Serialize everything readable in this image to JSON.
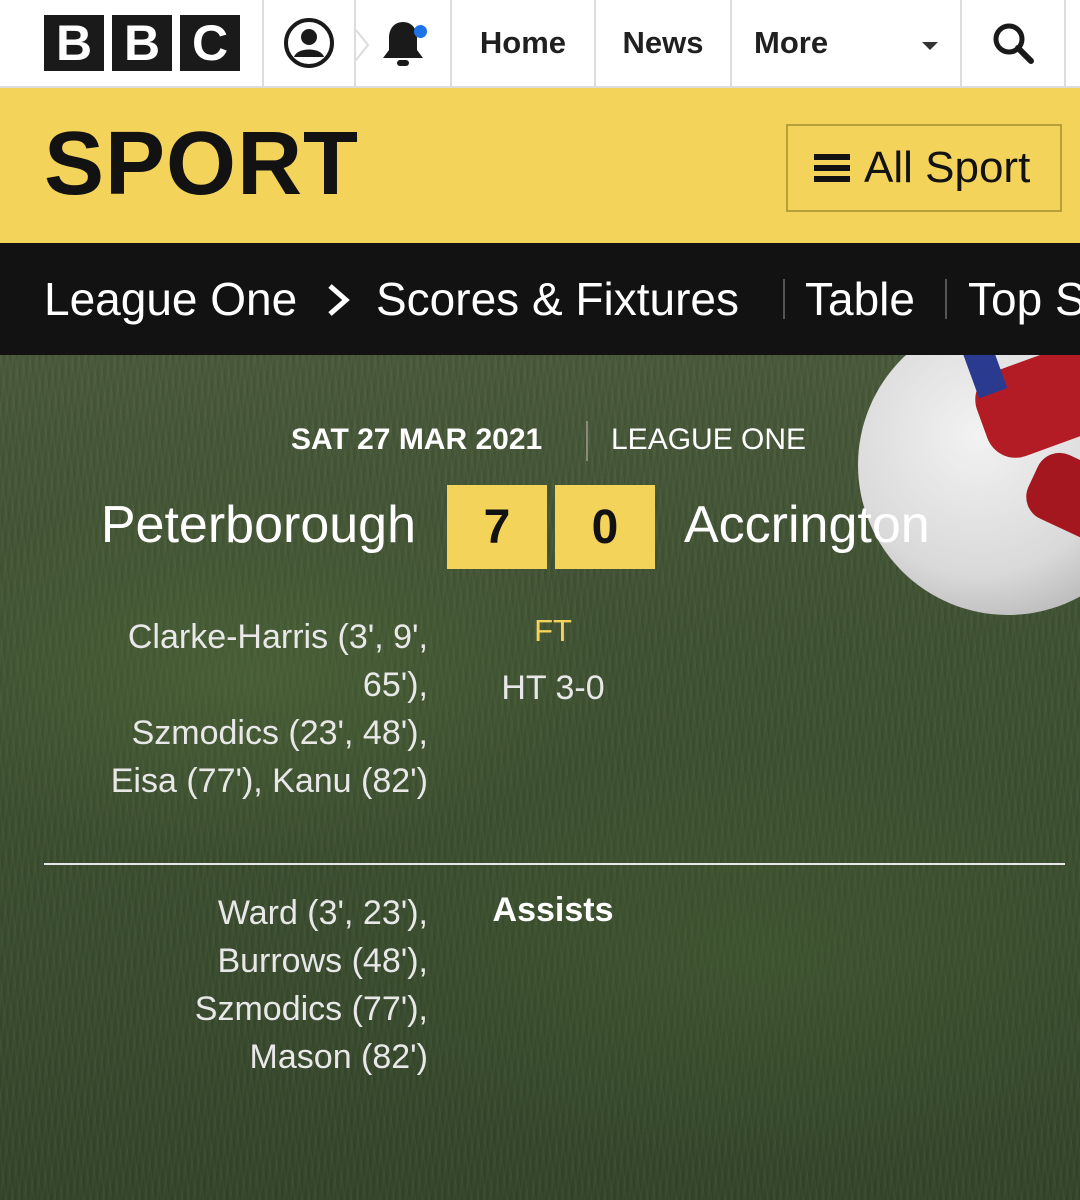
{
  "header": {
    "logo": "BBC",
    "nav": {
      "home": "Home",
      "news": "News",
      "more": "More"
    }
  },
  "sport_banner": {
    "title": "SPORT",
    "all_sport": "All Sport"
  },
  "league_nav": {
    "items": [
      "League One",
      "Scores & Fixtures",
      "Table",
      "Top S"
    ]
  },
  "match": {
    "date": "SAT 27 MAR 2021",
    "competition": "LEAGUE ONE",
    "home_team": "Peterborough",
    "away_team": "Accrington",
    "home_score": "7",
    "away_score": "0",
    "status": "FT",
    "half_time": "HT 3-0",
    "home_scorers": [
      "Clarke-Harris (3', 9',",
      "65'),",
      "Szmodics (23', 48'),",
      "Eisa (77'), Kanu (82')"
    ],
    "assists_label": "Assists",
    "home_assists": [
      "Ward (3', 23'),",
      "Burrows (48'),",
      "Szmodics (77'),",
      "Mason (82')"
    ]
  },
  "colors": {
    "accent": "#f4d35a",
    "dark": "#121212",
    "notification": "#1e73e8"
  }
}
